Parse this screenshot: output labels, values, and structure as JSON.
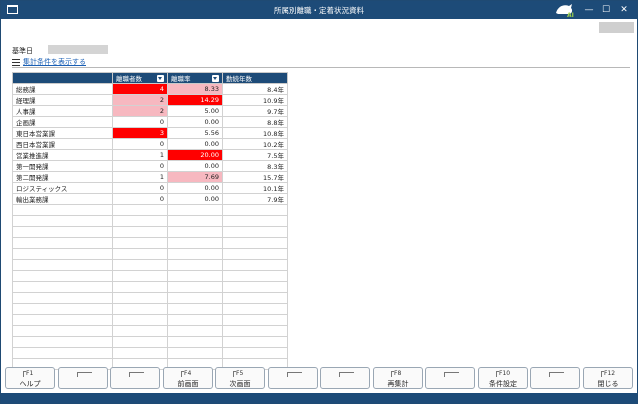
{
  "window": {
    "title": "所属別離職・定着状況資料",
    "logo_text": "AI",
    "minimize": "—",
    "maximize": "☐",
    "close": "✕"
  },
  "base_date": {
    "label": "基準日",
    "value": ""
  },
  "cond_link": "集計条件を表示する",
  "table": {
    "columns": [
      "",
      "離職者数",
      "離職率",
      "勤続年数"
    ],
    "rows": [
      {
        "dept": "総務課",
        "count": "4",
        "rate": "8.33",
        "years": "8.4年",
        "count_level": "hot",
        "rate_level": "warm"
      },
      {
        "dept": "経理課",
        "count": "2",
        "rate": "14.29",
        "years": "10.9年",
        "count_level": "warm",
        "rate_level": "hot"
      },
      {
        "dept": "人事課",
        "count": "2",
        "rate": "5.00",
        "years": "9.7年",
        "count_level": "warm",
        "rate_level": ""
      },
      {
        "dept": "企画課",
        "count": "0",
        "rate": "0.00",
        "years": "8.8年",
        "count_level": "",
        "rate_level": ""
      },
      {
        "dept": "東日本営業課",
        "count": "3",
        "rate": "5.56",
        "years": "10.8年",
        "count_level": "hot",
        "rate_level": ""
      },
      {
        "dept": "西日本営業課",
        "count": "0",
        "rate": "0.00",
        "years": "10.2年",
        "count_level": "",
        "rate_level": ""
      },
      {
        "dept": "営業推進課",
        "count": "1",
        "rate": "20.00",
        "years": "7.5年",
        "count_level": "",
        "rate_level": "hot"
      },
      {
        "dept": "第一開発課",
        "count": "0",
        "rate": "0.00",
        "years": "8.3年",
        "count_level": "",
        "rate_level": ""
      },
      {
        "dept": "第二開発課",
        "count": "1",
        "rate": "7.69",
        "years": "15.7年",
        "count_level": "",
        "rate_level": "warm"
      },
      {
        "dept": "ロジスティックス",
        "count": "0",
        "rate": "0.00",
        "years": "10.1年",
        "count_level": "",
        "rate_level": ""
      },
      {
        "dept": "輸出業務課",
        "count": "0",
        "rate": "0.00",
        "years": "7.9年",
        "count_level": "",
        "rate_level": ""
      }
    ],
    "empty_rows": 15
  },
  "fkeys": [
    {
      "num": "F1",
      "label": "ヘルプ"
    },
    {
      "num": "",
      "label": ""
    },
    {
      "num": "",
      "label": ""
    },
    {
      "num": "F4",
      "label": "前画面"
    },
    {
      "num": "F5",
      "label": "次画面"
    },
    {
      "num": "",
      "label": ""
    },
    {
      "num": "",
      "label": ""
    },
    {
      "num": "F8",
      "label": "再集計"
    },
    {
      "num": "",
      "label": ""
    },
    {
      "num": "F10",
      "label": "条件設定"
    },
    {
      "num": "",
      "label": ""
    },
    {
      "num": "F12",
      "label": "閉じる"
    }
  ],
  "colors": {
    "accent": "#1d4b78",
    "hot": "#ff0000",
    "warm": "#f7b8c0"
  }
}
